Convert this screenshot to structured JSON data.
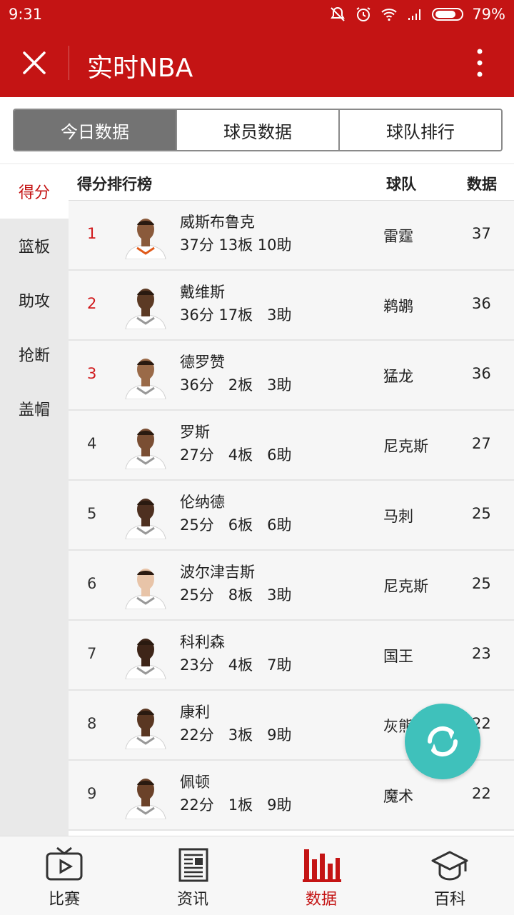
{
  "status_bar": {
    "time": "9:31",
    "battery": "79%"
  },
  "header": {
    "title": "实时NBA"
  },
  "tabs": [
    {
      "label": "今日数据",
      "active": true
    },
    {
      "label": "球员数据",
      "active": false
    },
    {
      "label": "球队排行",
      "active": false
    }
  ],
  "sidebar": {
    "items": [
      {
        "label": "得分",
        "active": true
      },
      {
        "label": "篮板",
        "active": false
      },
      {
        "label": "助攻",
        "active": false
      },
      {
        "label": "抢断",
        "active": false
      },
      {
        "label": "盖帽",
        "active": false
      }
    ]
  },
  "table": {
    "title": "得分排行榜",
    "col_team": "球队",
    "col_value": "数据",
    "rows": [
      {
        "rank": "1",
        "name": "威斯布鲁克",
        "stats": "37分 13板 10助",
        "team": "雷霆",
        "value": "37"
      },
      {
        "rank": "2",
        "name": "戴维斯",
        "stats": "36分 17板   3助",
        "team": "鹈鹕",
        "value": "36"
      },
      {
        "rank": "3",
        "name": "德罗赞",
        "stats": "36分   2板   3助",
        "team": "猛龙",
        "value": "36"
      },
      {
        "rank": "4",
        "name": "罗斯",
        "stats": "27分   4板   6助",
        "team": "尼克斯",
        "value": "27"
      },
      {
        "rank": "5",
        "name": "伦纳德",
        "stats": "25分   6板   6助",
        "team": "马刺",
        "value": "25"
      },
      {
        "rank": "6",
        "name": "波尔津吉斯",
        "stats": "25分   8板   3助",
        "team": "尼克斯",
        "value": "25"
      },
      {
        "rank": "7",
        "name": "科利森",
        "stats": "23分   4板   7助",
        "team": "国王",
        "value": "23"
      },
      {
        "rank": "8",
        "name": "康利",
        "stats": "22分   3板   9助",
        "team": "灰熊",
        "value": "22"
      },
      {
        "rank": "9",
        "name": "佩顿",
        "stats": "22分   1板   9助",
        "team": "魔术",
        "value": "22"
      }
    ]
  },
  "bottom_nav": [
    {
      "label": "比赛",
      "icon": "tv-icon",
      "active": false
    },
    {
      "label": "资讯",
      "icon": "newspaper-icon",
      "active": false
    },
    {
      "label": "数据",
      "icon": "bar-chart-icon",
      "active": true
    },
    {
      "label": "百科",
      "icon": "graduation-cap-icon",
      "active": false
    }
  ],
  "colors": {
    "brand": "#c41414",
    "fab": "#3fc1bb",
    "tab_active": "#737373"
  }
}
